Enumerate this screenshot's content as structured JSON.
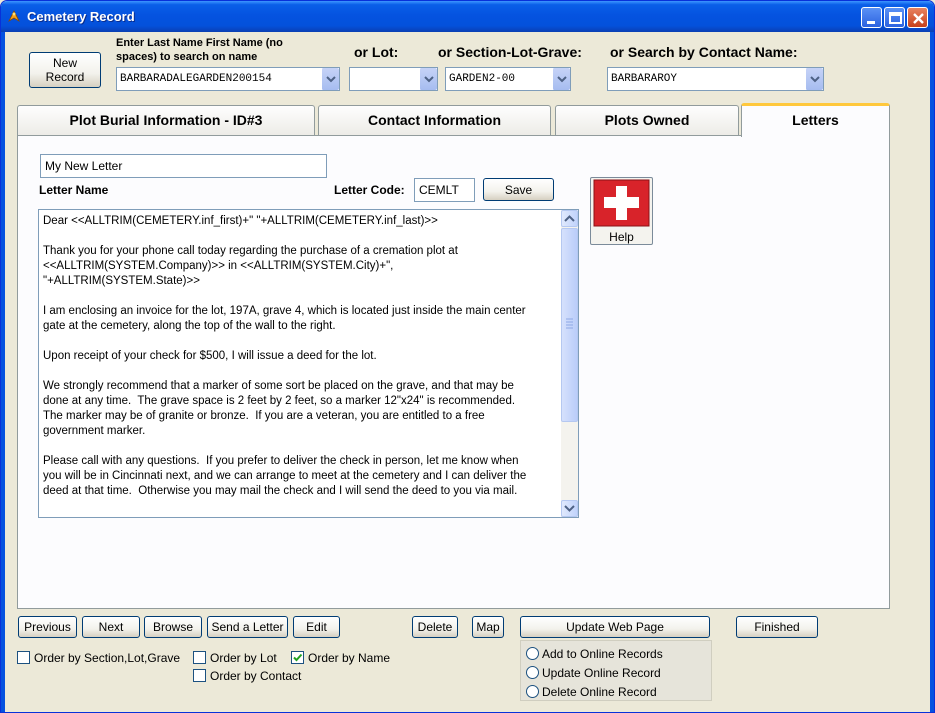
{
  "window": {
    "title": "Cemetery Record",
    "icon": "cemetery-app-icon"
  },
  "search": {
    "new_record_label": "New\nRecord",
    "name_label": "Enter Last Name First Name (no spaces) to search on name",
    "name_value": "BARBARADALEGARDEN200154",
    "lot_label": "or Lot:",
    "lot_value": "",
    "slg_label": "or Section-Lot-Grave:",
    "slg_value": "GARDEN2-00",
    "contact_label": "or Search by Contact Name:",
    "contact_value": "BARBARAROY"
  },
  "tabs": [
    {
      "label": "Plot Burial Information - ID#3",
      "active": false
    },
    {
      "label": "Contact Information",
      "active": false
    },
    {
      "label": "Plots Owned",
      "active": false
    },
    {
      "label": "Letters",
      "active": true
    }
  ],
  "letters": {
    "letter_name_value": "My New Letter",
    "letter_name_label": "Letter Name",
    "letter_code_label": "Letter Code:",
    "letter_code_value": "CEMLT",
    "save_label": "Save",
    "help_label": "Help",
    "body": "Dear <<ALLTRIM(CEMETERY.inf_first)+\" \"+ALLTRIM(CEMETERY.inf_last)>>\n\nThank you for your phone call today regarding the purchase of a cremation plot at\n<<ALLTRIM(SYSTEM.Company)>> in <<ALLTRIM(SYSTEM.City)+\",\n\"+ALLTRIM(SYSTEM.State)>>\n\nI am enclosing an invoice for the lot, 197A, grave 4, which is located just inside the main center\ngate at the cemetery, along the top of the wall to the right.\n\nUpon receipt of your check for $500, I will issue a deed for the lot.\n\nWe strongly recommend that a marker of some sort be placed on the grave, and that may be\ndone at any time.  The grave space is 2 feet by 2 feet, so a marker 12\"x24\" is recommended.\nThe marker may be of granite or bronze.  If you are a veteran, you are entitled to a free\ngovernment marker.\n\nPlease call with any questions.  If you prefer to deliver the check in person, let me know when\nyou will be in Cincinnati next, and we can arrange to meet at the cemetery and I can deliver the\ndeed at that time.  Otherwise you may mail the check and I will send the deed to you via mail."
  },
  "footer": {
    "previous": "Previous",
    "next": "Next",
    "browse": "Browse",
    "send_letter": "Send a Letter",
    "edit": "Edit",
    "delete": "Delete",
    "map": "Map",
    "update_web": "Update Web Page",
    "finished": "Finished",
    "order_slg": "Order by Section,Lot,Grave",
    "order_lot": "Order by Lot",
    "order_name": "Order by Name",
    "order_contact": "Order by Contact",
    "order_name_checked": true,
    "radio_add": "Add to Online Records",
    "radio_update": "Update Online Record",
    "radio_delete": "Delete Online Record"
  }
}
